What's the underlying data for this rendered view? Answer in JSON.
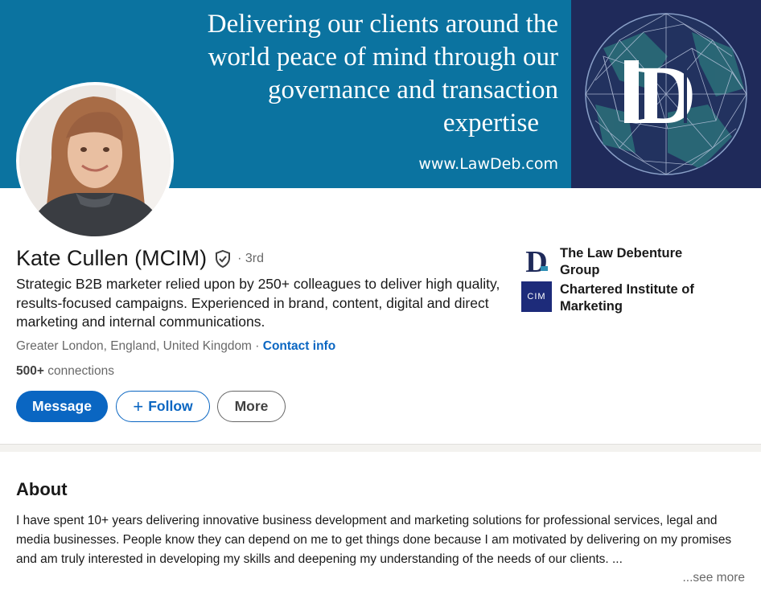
{
  "banner": {
    "tagline_lines": [
      "Delivering our clients around the",
      "world peace of mind through our",
      "governance and transaction",
      "expertise"
    ],
    "url": "www.LawDeb.com",
    "logo_icon": "law-debenture-globe-logo",
    "colors": {
      "left": "#0b73a0",
      "right": "#1f2a5a"
    }
  },
  "profile": {
    "name": "Kate Cullen (MCIM)",
    "verified_icon": "shield-check-icon",
    "degree": "· 3rd",
    "headline": "Strategic B2B marketer relied upon by 250+ colleagues to deliver high quality, results-focused campaigns. Experienced in brand, content, digital and direct marketing and internal communications.",
    "location": "Greater London, England, United Kingdom",
    "separator": " · ",
    "contact_info": "Contact info",
    "connections_count": "500+",
    "connections_label": " connections"
  },
  "actions": {
    "message": "Message",
    "follow_plus": "+",
    "follow": "Follow",
    "more": "More"
  },
  "companies": [
    {
      "name": "The Law Debenture Group",
      "logo": "law-debenture-logo"
    },
    {
      "name": "Chartered Institute of Marketing",
      "logo_text": "CIM"
    }
  ],
  "about": {
    "title": "About",
    "text": "I have spent 10+ years delivering innovative business development and marketing solutions for professional services, legal and media businesses. People know they can depend on me to get things done because I am motivated by delivering on my promises and am truly interested in developing my skills and deepening my understanding of the needs of our clients. ...",
    "see_more": "...see more"
  },
  "colors": {
    "accent": "#0a66c2",
    "page_bg": "#f3f2ef"
  }
}
